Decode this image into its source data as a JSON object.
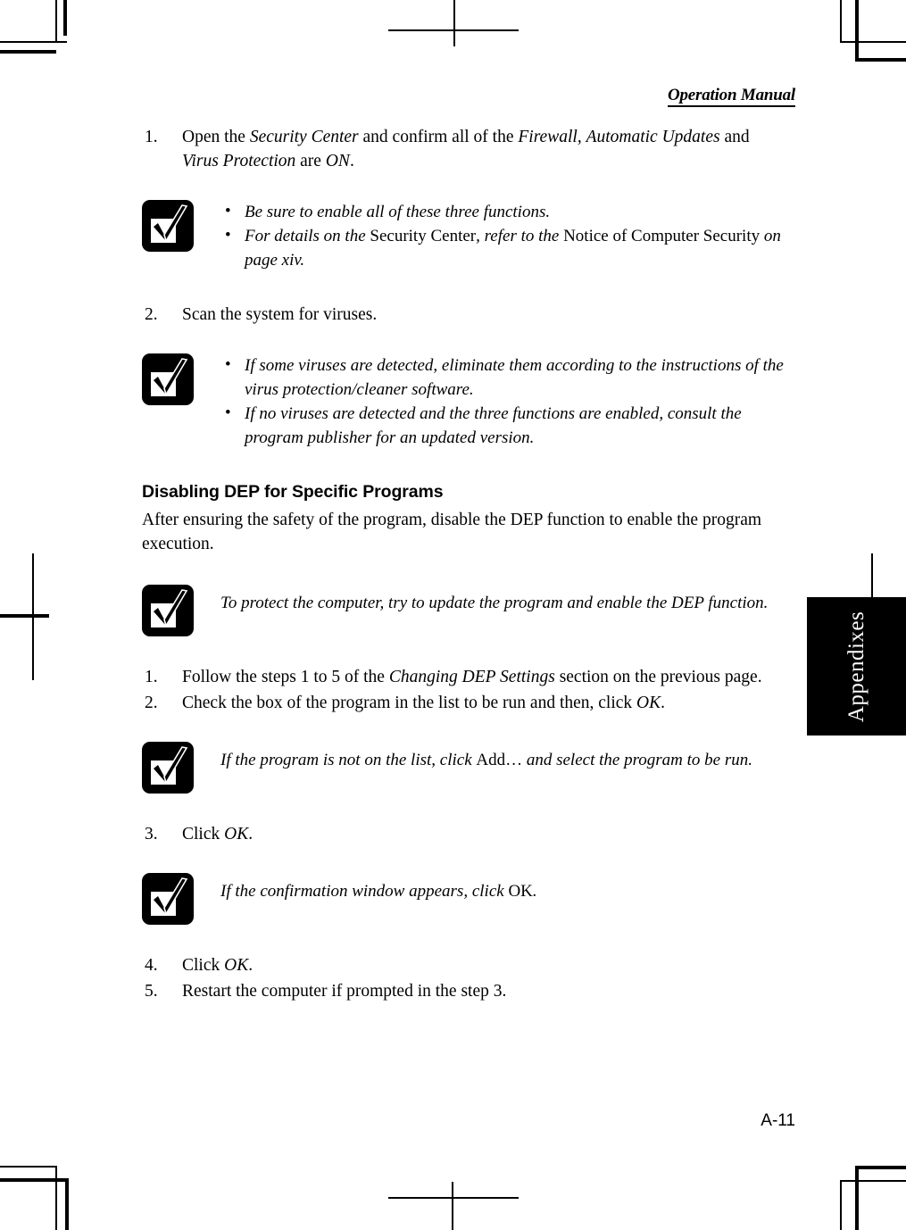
{
  "page": {
    "header_title": "Operation Manual",
    "folio": "A-11",
    "thumb_tab_label": "Appendixes"
  },
  "icons": {
    "note_icon": "check-mark-icon"
  },
  "blocks": [
    {
      "kind": "step",
      "number": "1.",
      "runs": [
        {
          "t": "Open the ",
          "s": "roman"
        },
        {
          "t": "Security Center",
          "s": "ital"
        },
        {
          "t": " and confirm all of the ",
          "s": "roman"
        },
        {
          "t": "Firewall",
          "s": "ital"
        },
        {
          "t": ", ",
          "s": "roman"
        },
        {
          "t": "Automatic Updates",
          "s": "ital"
        },
        {
          "t": " and ",
          "s": "roman"
        },
        {
          "t": "Virus Protection",
          "s": "ital"
        },
        {
          "t": " are ",
          "s": "roman"
        },
        {
          "t": "ON",
          "s": "ital"
        },
        {
          "t": ".",
          "s": "roman"
        }
      ]
    },
    {
      "kind": "note-list",
      "items": [
        [
          {
            "t": "Be sure to enable all of these three functions.",
            "s": "ital"
          }
        ],
        [
          {
            "t": "For details on the ",
            "s": "ital"
          },
          {
            "t": "Security Center",
            "s": "roman"
          },
          {
            "t": ", refer to the ",
            "s": "ital"
          },
          {
            "t": "Notice of Computer Security",
            "s": "roman"
          },
          {
            "t": " on page xiv.",
            "s": "ital"
          }
        ]
      ]
    },
    {
      "kind": "step",
      "number": "2.",
      "runs": [
        {
          "t": "Scan the system for viruses.",
          "s": "roman"
        }
      ]
    },
    {
      "kind": "note-list",
      "items": [
        [
          {
            "t": "If some viruses are detected, eliminate them according to the instructions of the virus protection/cleaner software.",
            "s": "ital"
          }
        ],
        [
          {
            "t": "If no viruses are detected and the three functions are enabled, consult the program publisher for an updated version.",
            "s": "ital"
          }
        ]
      ]
    },
    {
      "kind": "heading",
      "text": "Disabling DEP for Specific Programs"
    },
    {
      "kind": "para",
      "runs": [
        {
          "t": "After ensuring the safety of the program, disable the DEP function to enable the program execution.",
          "s": "roman"
        }
      ]
    },
    {
      "kind": "note",
      "runs": [
        {
          "t": "To protect the computer, try to update the program and enable the DEP function.",
          "s": "ital"
        }
      ]
    },
    {
      "kind": "step",
      "number": "1.",
      "runs": [
        {
          "t": "Follow the steps 1 to 5 of the ",
          "s": "roman"
        },
        {
          "t": "Changing DEP Settings",
          "s": "ital"
        },
        {
          "t": " section on the previous page.",
          "s": "roman"
        }
      ]
    },
    {
      "kind": "step",
      "number": "2.",
      "runs": [
        {
          "t": "Check the box of the program in the list to be run and then, click ",
          "s": "roman"
        },
        {
          "t": "OK",
          "s": "ital"
        },
        {
          "t": ".",
          "s": "roman"
        }
      ]
    },
    {
      "kind": "note",
      "runs": [
        {
          "t": "If the program is not on the list, click ",
          "s": "ital"
        },
        {
          "t": "Add…",
          "s": "roman"
        },
        {
          "t": " and select the program to be run.",
          "s": "ital"
        }
      ]
    },
    {
      "kind": "step",
      "number": "3.",
      "runs": [
        {
          "t": "Click ",
          "s": "roman"
        },
        {
          "t": "OK",
          "s": "ital"
        },
        {
          "t": ".",
          "s": "roman"
        }
      ]
    },
    {
      "kind": "note",
      "runs": [
        {
          "t": "If the confirmation window appears, click ",
          "s": "ital"
        },
        {
          "t": "OK",
          "s": "roman"
        },
        {
          "t": ".",
          "s": "ital"
        }
      ]
    },
    {
      "kind": "step",
      "number": "4.",
      "runs": [
        {
          "t": "Click ",
          "s": "roman"
        },
        {
          "t": "OK",
          "s": "ital"
        },
        {
          "t": ".",
          "s": "roman"
        }
      ]
    },
    {
      "kind": "step",
      "number": "5.",
      "runs": [
        {
          "t": "Restart the computer if prompted in the step 3.",
          "s": "roman"
        }
      ]
    }
  ],
  "bullet_glyph": "•"
}
